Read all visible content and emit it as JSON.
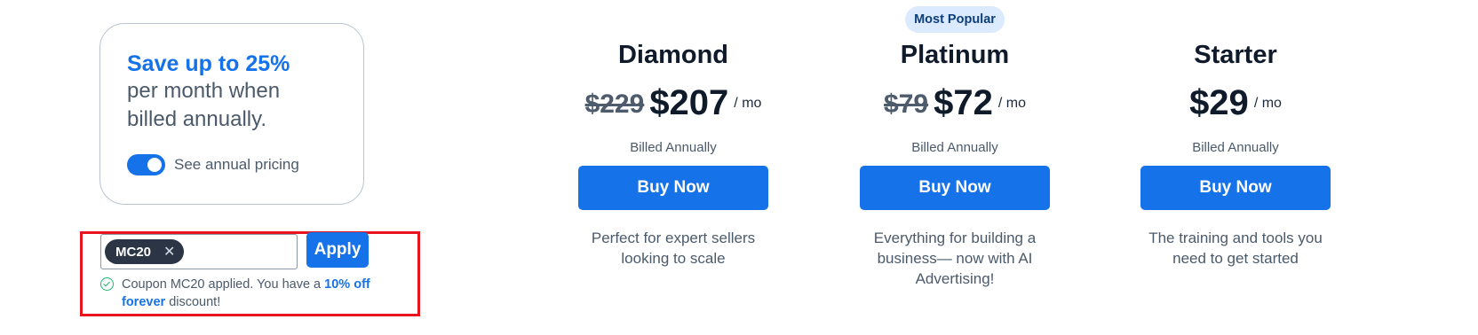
{
  "promo": {
    "headline": "Save up to 25%",
    "subtext": "per month when billed annually.",
    "toggle_label": "See annual pricing",
    "toggle_on": true
  },
  "coupon": {
    "code": "MC20",
    "remove_glyph": "✕",
    "apply_label": "Apply",
    "message_prefix": "Coupon MC20 applied. You have a ",
    "message_highlight": "10% off forever",
    "message_suffix": " discount!"
  },
  "plans": [
    {
      "name": "Diamond",
      "badge": "",
      "old_price": "$229",
      "price": "$207",
      "period": "/ mo",
      "billing": "Billed Annually",
      "button_label": "Buy Now",
      "description": "Perfect for expert sellers looking to scale"
    },
    {
      "name": "Platinum",
      "badge": "Most Popular",
      "old_price": "$79",
      "price": "$72",
      "period": "/ mo",
      "billing": "Billed Annually",
      "button_label": "Buy Now",
      "description": "Everything for building a business— now with AI Advertising!"
    },
    {
      "name": "Starter",
      "badge": "",
      "old_price": "",
      "price": "$29",
      "period": "/ mo",
      "billing": "Billed Annually",
      "button_label": "Buy Now",
      "description": "The training and tools you need to get started"
    }
  ],
  "colors": {
    "accent": "#1572e8",
    "badge_bg": "#dbeafe",
    "success": "#22b46e",
    "highlight_frame": "#e8141f",
    "chip_bg": "#2b3546"
  }
}
